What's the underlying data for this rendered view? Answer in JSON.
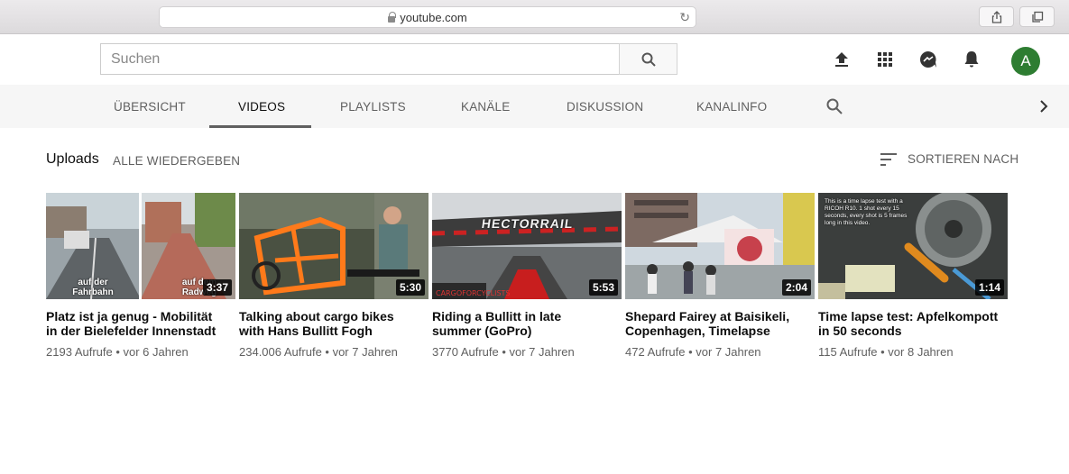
{
  "browser": {
    "url": "youtube.com",
    "reload_glyph": "↻"
  },
  "header": {
    "search_placeholder": "Suchen",
    "avatar_letter": "A"
  },
  "tabs": [
    {
      "label": "ÜBERSICHT"
    },
    {
      "label": "VIDEOS"
    },
    {
      "label": "PLAYLISTS"
    },
    {
      "label": "KANÄLE"
    },
    {
      "label": "DISKUSSION"
    },
    {
      "label": "KANALINFO"
    }
  ],
  "active_tab": "VIDEOS",
  "section": {
    "title": "Uploads",
    "play_all": "ALLE WIEDERGEBEN",
    "sort_label": "SORTIEREN NACH"
  },
  "videos": [
    {
      "title": "Platz ist ja genug - Mobilität in der Bielefelder Innenstadt",
      "meta": "2193 Aufrufe • vor 6 Jahren",
      "duration": "3:37",
      "thumb_text_left": "auf der Fahrbahn",
      "thumb_text_right": "auf dem Radweg"
    },
    {
      "title": "Talking about cargo bikes with Hans Bullitt Fogh",
      "meta": "234.006 Aufrufe • vor 7 Jahren",
      "duration": "5:30"
    },
    {
      "title": "Riding a Bullitt in late summer (GoPro)",
      "meta": "3770 Aufrufe • vor 7 Jahren",
      "duration": "5:53",
      "thumb_text_banner": "HECTORRAIL"
    },
    {
      "title": "Shepard Fairey at Baisikeli, Copenhagen, Timelapse",
      "meta": "472 Aufrufe • vor 7 Jahren",
      "duration": "2:04"
    },
    {
      "title": "Time lapse test: Apfelkompott in 50 seconds",
      "meta": "115 Aufrufe • vor 8 Jahren",
      "duration": "1:14",
      "thumb_text_note": "This is a time lapse test with a RICOH R10. 1 shot every 15 seconds, every shot is 5 frames long in this video."
    }
  ],
  "colors": {
    "avatar": "#2e7d32",
    "tab_bar": "#f6f6f6",
    "secondary_text": "#606060"
  },
  "icons": [
    "lock-icon",
    "reload-icon",
    "share-icon",
    "tabs-icon",
    "search-icon",
    "upload-icon",
    "apps-icon",
    "messages-icon",
    "bell-icon",
    "sort-icon",
    "chevron-right-icon"
  ]
}
